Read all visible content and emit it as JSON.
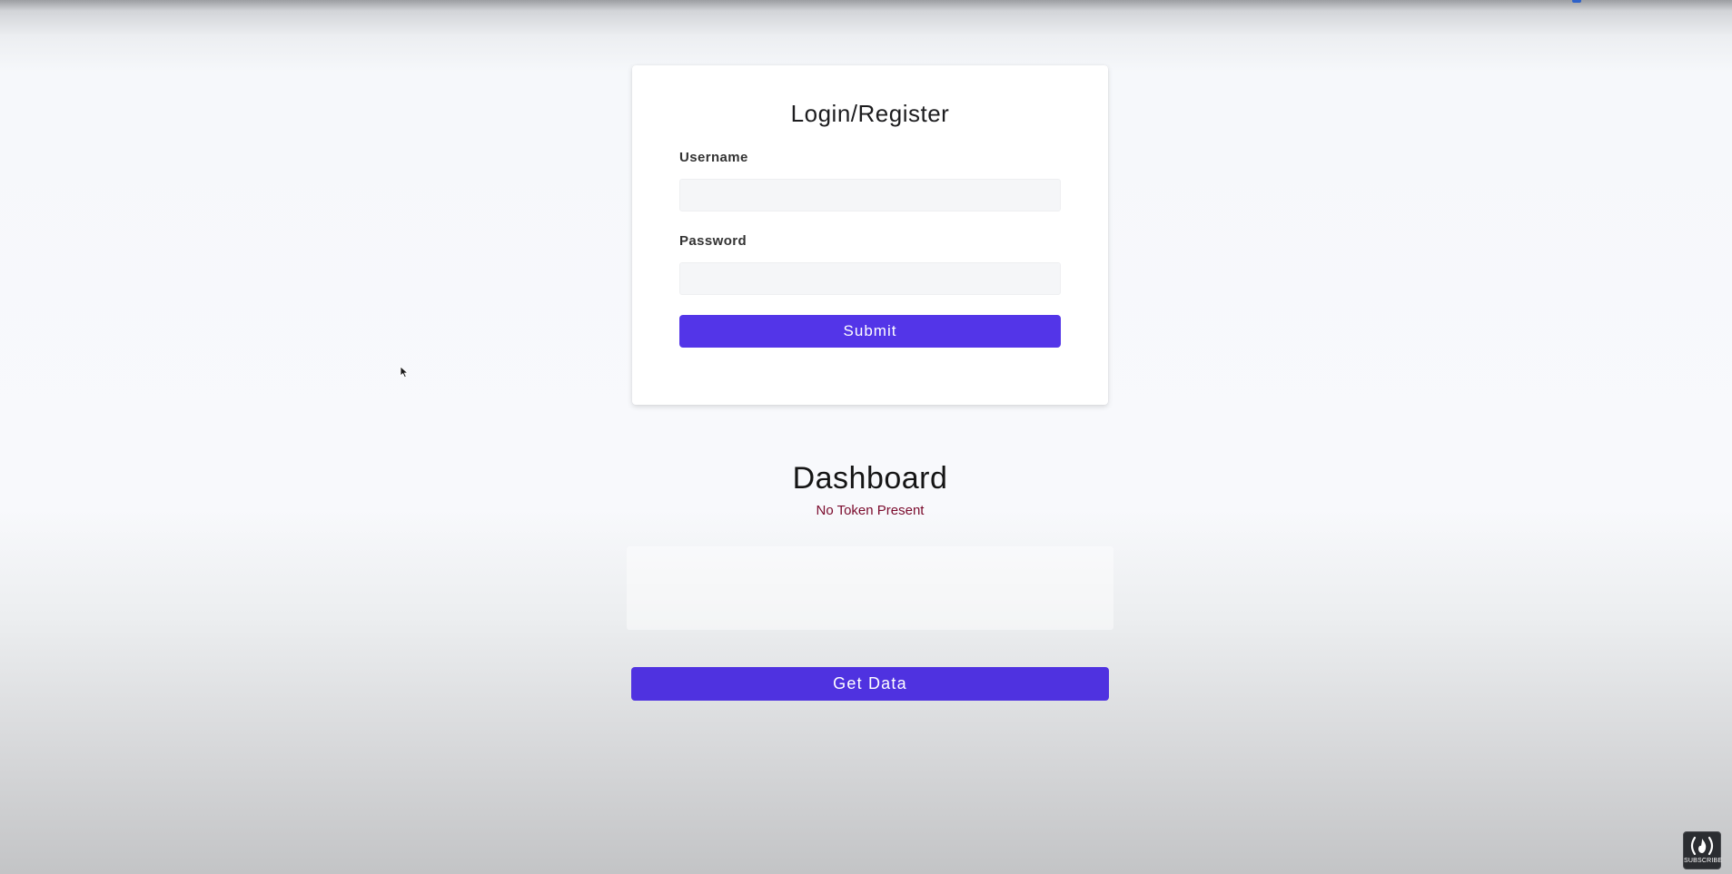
{
  "login_card": {
    "title": "Login/Register",
    "username_label": "Username",
    "username_value": "",
    "password_label": "Password",
    "password_value": "",
    "submit_label": "Submit"
  },
  "dashboard": {
    "title": "Dashboard",
    "status": "No Token Present",
    "get_data_label": "Get Data"
  },
  "overlay": {
    "subscribe_label": "SUBSCRIBE"
  },
  "colors": {
    "accent": "#5335e8",
    "status_text": "#7a0a2c"
  },
  "icons": [
    "mouse-pointer-icon",
    "freecodecamp-logo-icon"
  ]
}
